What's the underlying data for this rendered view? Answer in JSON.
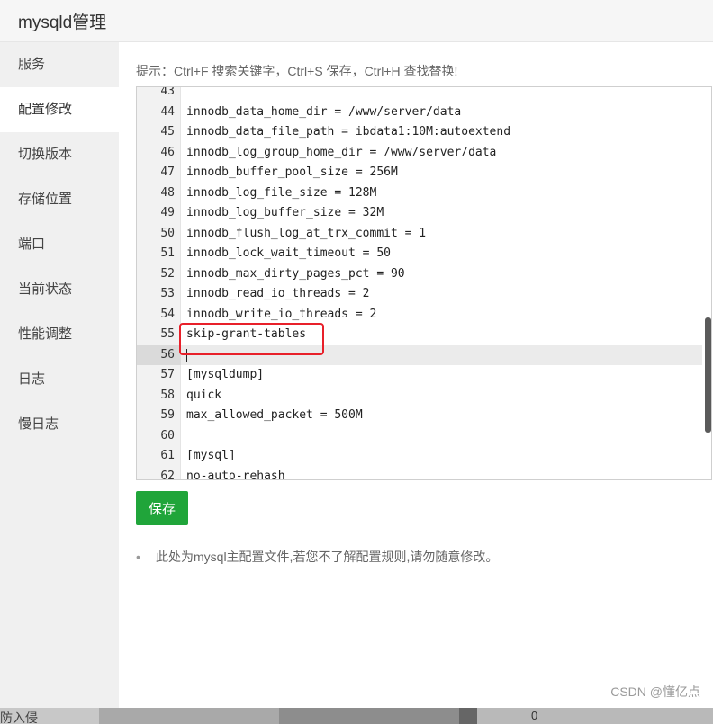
{
  "window": {
    "title": "mysqld管理"
  },
  "sidebar": {
    "items": [
      {
        "label": "服务",
        "active": false
      },
      {
        "label": "配置修改",
        "active": true
      },
      {
        "label": "切换版本",
        "active": false
      },
      {
        "label": "存储位置",
        "active": false
      },
      {
        "label": "端口",
        "active": false
      },
      {
        "label": "当前状态",
        "active": false
      },
      {
        "label": "性能调整",
        "active": false
      },
      {
        "label": "日志",
        "active": false
      },
      {
        "label": "慢日志",
        "active": false
      }
    ]
  },
  "main": {
    "hint": "提示：Ctrl+F 搜索关键字，Ctrl+S 保存，Ctrl+H 查找替换!",
    "editor": {
      "current_line": 56,
      "lines": [
        {
          "num": "43",
          "text": ""
        },
        {
          "num": "44",
          "text": "innodb_data_home_dir = /www/server/data"
        },
        {
          "num": "45",
          "text": "innodb_data_file_path = ibdata1:10M:autoextend"
        },
        {
          "num": "46",
          "text": "innodb_log_group_home_dir = /www/server/data"
        },
        {
          "num": "47",
          "text": "innodb_buffer_pool_size = 256M"
        },
        {
          "num": "48",
          "text": "innodb_log_file_size = 128M"
        },
        {
          "num": "49",
          "text": "innodb_log_buffer_size = 32M"
        },
        {
          "num": "50",
          "text": "innodb_flush_log_at_trx_commit = 1"
        },
        {
          "num": "51",
          "text": "innodb_lock_wait_timeout = 50"
        },
        {
          "num": "52",
          "text": "innodb_max_dirty_pages_pct = 90"
        },
        {
          "num": "53",
          "text": "innodb_read_io_threads = 2"
        },
        {
          "num": "54",
          "text": "innodb_write_io_threads = 2"
        },
        {
          "num": "55",
          "text": "skip-grant-tables"
        },
        {
          "num": "56",
          "text": ""
        },
        {
          "num": "57",
          "text": "[mysqldump]"
        },
        {
          "num": "58",
          "text": "quick"
        },
        {
          "num": "59",
          "text": "max_allowed_packet = 500M"
        },
        {
          "num": "60",
          "text": ""
        },
        {
          "num": "61",
          "text": "[mysql]"
        },
        {
          "num": "62",
          "text": "no-auto-rehash"
        }
      ]
    },
    "save_label": "保存",
    "note": "此处为mysql主配置文件,若您不了解配置规则,请勿随意修改。"
  },
  "watermark": "CSDN @懂亿点",
  "taskbar": {
    "label": "防入侵",
    "number": "0"
  },
  "colors": {
    "accent_green": "#20a53a",
    "highlight_red": "#e8202a",
    "sidebar_bg": "#f0f0f0"
  }
}
